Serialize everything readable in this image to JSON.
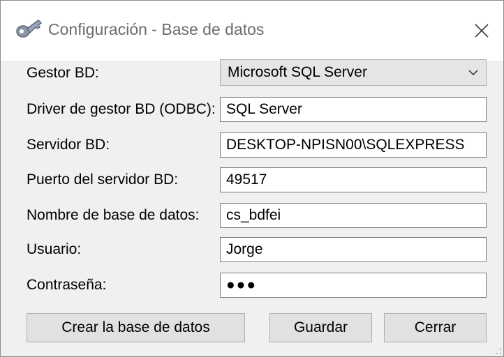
{
  "window": {
    "title": "Configuración - Base de datos",
    "app_icon": "app-key-icon",
    "close_icon": "close-icon"
  },
  "form": {
    "gestor": {
      "label": "Gestor BD:",
      "selected": "Microsoft SQL Server"
    },
    "driver": {
      "label": "Driver de gestor BD (ODBC):",
      "value": "SQL Server"
    },
    "servidor": {
      "label": "Servidor BD:",
      "value": "DESKTOP-NPISN00\\SQLEXPRESS"
    },
    "puerto": {
      "label": "Puerto del servidor BD:",
      "value": "49517"
    },
    "nombre": {
      "label": "Nombre de base de datos:",
      "value": "cs_bdfei"
    },
    "usuario": {
      "label": "Usuario:",
      "value": "Jorge"
    },
    "contrasena": {
      "label": "Contraseña:",
      "masked": "●●●"
    }
  },
  "buttons": {
    "crear": "Crear la base de datos",
    "guardar": "Guardar",
    "cerrar": "Cerrar"
  }
}
